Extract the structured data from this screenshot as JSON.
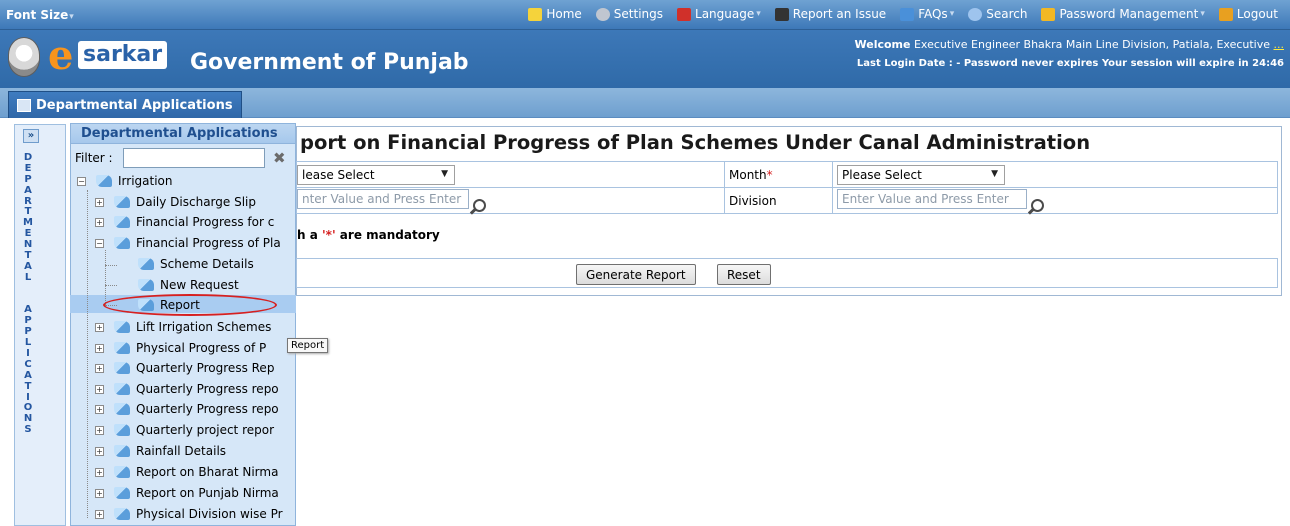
{
  "topbar": {
    "font_size": "Font Size",
    "menu": [
      {
        "label": "Home",
        "icon": "home-icon",
        "color": "#f5d33b"
      },
      {
        "label": "Settings",
        "icon": "gear-icon",
        "color": "#c0c6d0"
      },
      {
        "label": "Language",
        "icon": "language-icon",
        "color": "#d0302a"
      },
      {
        "label": "Report an Issue",
        "icon": "phone-icon",
        "color": "#333333"
      },
      {
        "label": "FAQs",
        "icon": "faq-icon",
        "color": "#4a90d9"
      },
      {
        "label": "Search",
        "icon": "search-icon",
        "color": "#9ec4ee"
      },
      {
        "label": "Password Management",
        "icon": "key-icon",
        "color": "#f2b824"
      },
      {
        "label": "Logout",
        "icon": "logout-icon",
        "color": "#e8a020"
      }
    ]
  },
  "header": {
    "logo_e": "e",
    "logo_text": "sarkar",
    "title": "Government of Punjab",
    "welcome_label": "Welcome",
    "welcome_text": "Executive Engineer Bhakra Main Line Division, Patiala, Executive",
    "welcome_more": "...",
    "last_login": "Last Login Date : -  Password never expires    Your session will expire in 24:46"
  },
  "tab": {
    "label": "Departmental Applications"
  },
  "vstrip": {
    "toggle": "»",
    "letters": [
      "D",
      "E",
      "P",
      "A",
      "R",
      "T",
      "M",
      "E",
      "N",
      "T",
      "A",
      "L",
      " ",
      " ",
      "A",
      "P",
      "P",
      "L",
      "I",
      "C",
      "A",
      "T",
      "I",
      "O",
      "N",
      "S"
    ]
  },
  "tree": {
    "title": "Departmental Applications",
    "filter_label": "Filter :",
    "filter_value": "",
    "root": "Irrigation",
    "items": [
      "Daily Discharge Slip",
      "Financial Progress for c",
      "Financial Progress of Pla",
      "Scheme Details",
      "New Request",
      "Report",
      "Lift Irrigation Schemes",
      "Physical Progress of P",
      "Quarterly Progress Rep",
      "Quarterly Progress repo",
      "Quarterly Progress repo",
      "Quarterly project repor",
      "Rainfall Details",
      "Report on Bharat Nirma",
      "Report on Punjab Nirma",
      "Physical Division wise Pr"
    ]
  },
  "tooltip": "Report",
  "form": {
    "title": "port on Financial Progress of Plan Schemes Under Canal Administration",
    "year_select": "lease Select",
    "month_label": "Month",
    "month_select": "Please Select",
    "scheme_placeholder": "nter Value and Press Enter",
    "division_label": "Division",
    "division_placeholder": "Enter Value and Press Enter",
    "mandatory_prefix": "h a ",
    "mandatory_star": "'*'",
    "mandatory_suffix": " are mandatory",
    "generate_label": "Generate Report",
    "reset_label": "Reset"
  }
}
